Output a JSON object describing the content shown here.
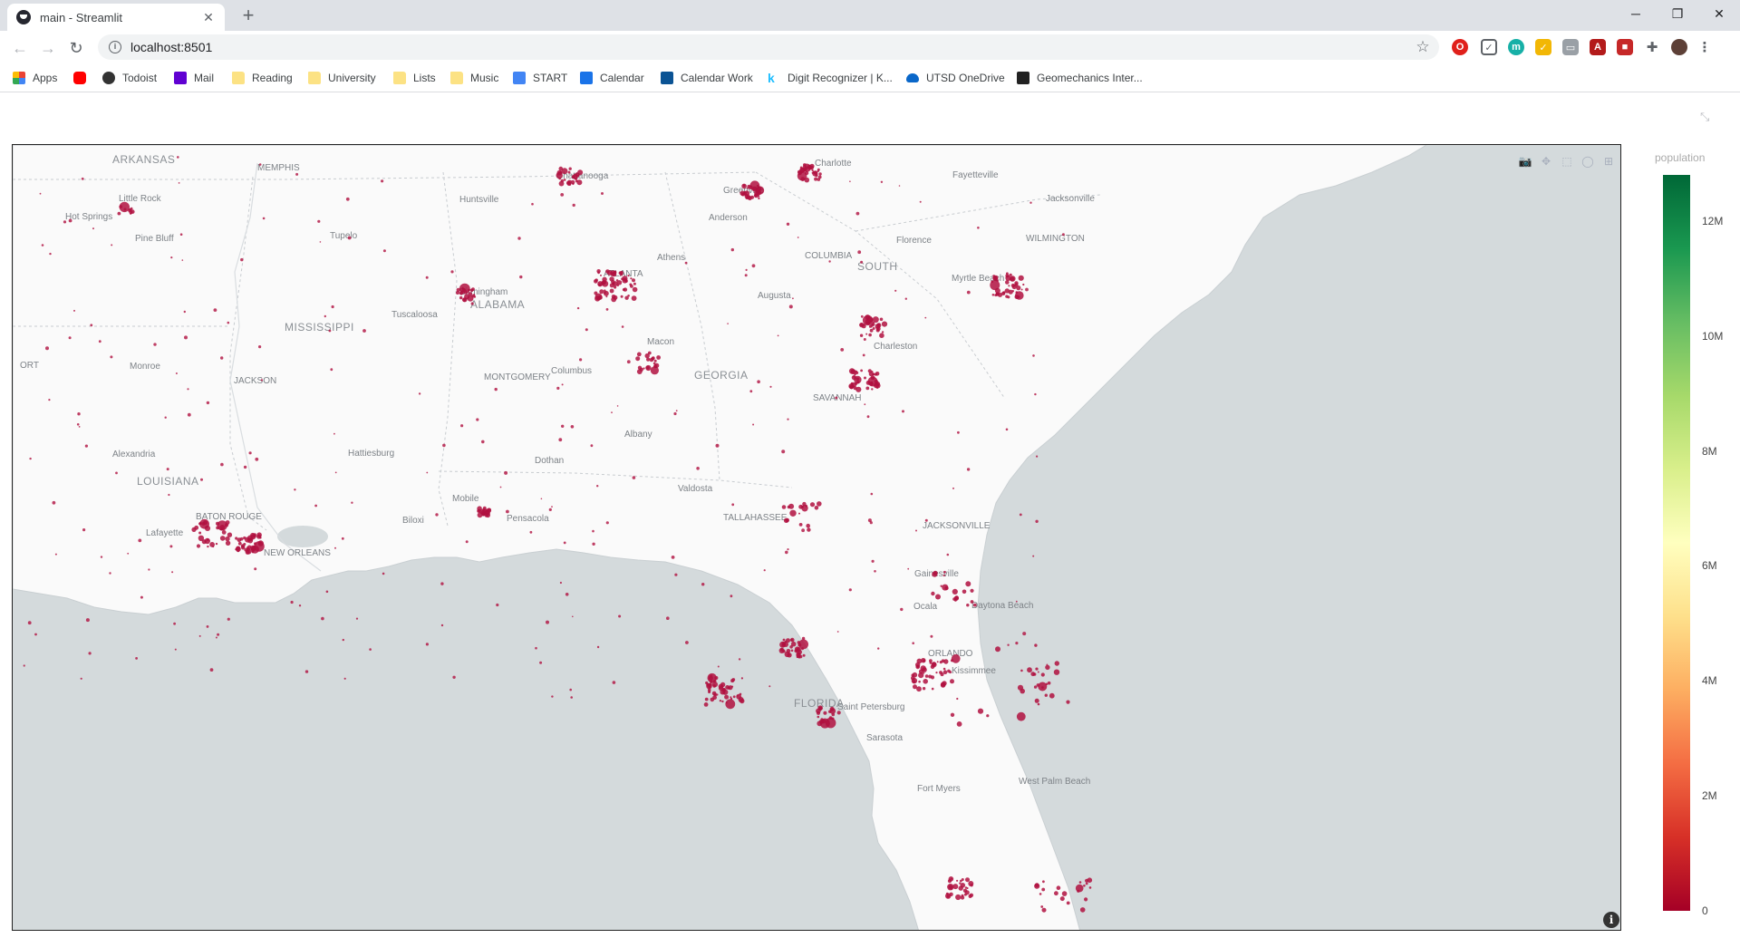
{
  "browser": {
    "tab_title": "main - Streamlit",
    "url": "localhost:8501",
    "bookmarks": [
      {
        "label": "Apps",
        "icon": "apps-grid-icon"
      },
      {
        "label": "",
        "icon": "youtube-icon"
      },
      {
        "label": "Todoist",
        "icon": "todoist-icon"
      },
      {
        "label": "Mail",
        "icon": "mail-icon"
      },
      {
        "label": "Reading",
        "icon": "folder-icon"
      },
      {
        "label": "University",
        "icon": "folder-icon"
      },
      {
        "label": "Lists",
        "icon": "folder-icon"
      },
      {
        "label": "Music",
        "icon": "folder-icon"
      },
      {
        "label": "START",
        "icon": "start-icon"
      },
      {
        "label": "Calendar",
        "icon": "calendar-icon"
      },
      {
        "label": "Calendar Work",
        "icon": "calendar-work-icon"
      },
      {
        "label": "Digit Recognizer | K...",
        "icon": "kaggle-icon"
      },
      {
        "label": "UTSD OneDrive",
        "icon": "onedrive-icon"
      },
      {
        "label": "Geomechanics Inter...",
        "icon": "geomechanics-icon"
      }
    ]
  },
  "map": {
    "type": "scatter_mapbox",
    "base_style": "carto-positron",
    "marker_color": "#b01040",
    "region_labels": [
      "ARKANSAS",
      "MISSISSIPPI",
      "ALABAMA",
      "GEORGIA",
      "SOUTH CAROLINA",
      "LOUISIANA",
      "FLORIDA"
    ],
    "city_labels": [
      "MEMPHIS",
      "Chattanooga",
      "Charlotte",
      "Fayetteville",
      "Little Rock",
      "Hot Springs",
      "Huntsville",
      "Greenville",
      "Jacksonville",
      "Pine Bluff",
      "Anderson",
      "Tupelo",
      "Florence",
      "WILMINGTON",
      "Athens",
      "COLUMBIA",
      "ATLANTA",
      "Birmingham",
      "Myrtle Beach",
      "Augusta",
      "Tuscaloosa",
      "Charleston",
      "Macon",
      "ORT",
      "Monroe",
      "Columbus",
      "JACKSON",
      "MONTGOMERY",
      "SAVANNAH",
      "Albany",
      "Alexandria",
      "Hattiesburg",
      "Dothan",
      "Valdosta",
      "Mobile",
      "Biloxi",
      "Pensacola",
      "BATON ROUGE",
      "TALLAHASSEE",
      "JACKSONVILLE",
      "Lafayette",
      "NEW ORLEANS",
      "Gainesville",
      "Ocala",
      "Daytona Beach",
      "ORLANDO",
      "Kissimmee",
      "Saint Petersburg",
      "Sarasota",
      "Fort Myers",
      "West Palm Beach"
    ]
  },
  "colorbar": {
    "title": "population",
    "min": 0,
    "max": 12000000,
    "colorscale": [
      "#a50026",
      "#d73027",
      "#f46d43",
      "#fdae61",
      "#fee08b",
      "#ffffbf",
      "#d9ef8b",
      "#a6d96a",
      "#66bd63",
      "#1a9850",
      "#006837"
    ],
    "ticks": [
      "12M",
      "10M",
      "8M",
      "6M",
      "4M",
      "2M",
      "0"
    ]
  }
}
